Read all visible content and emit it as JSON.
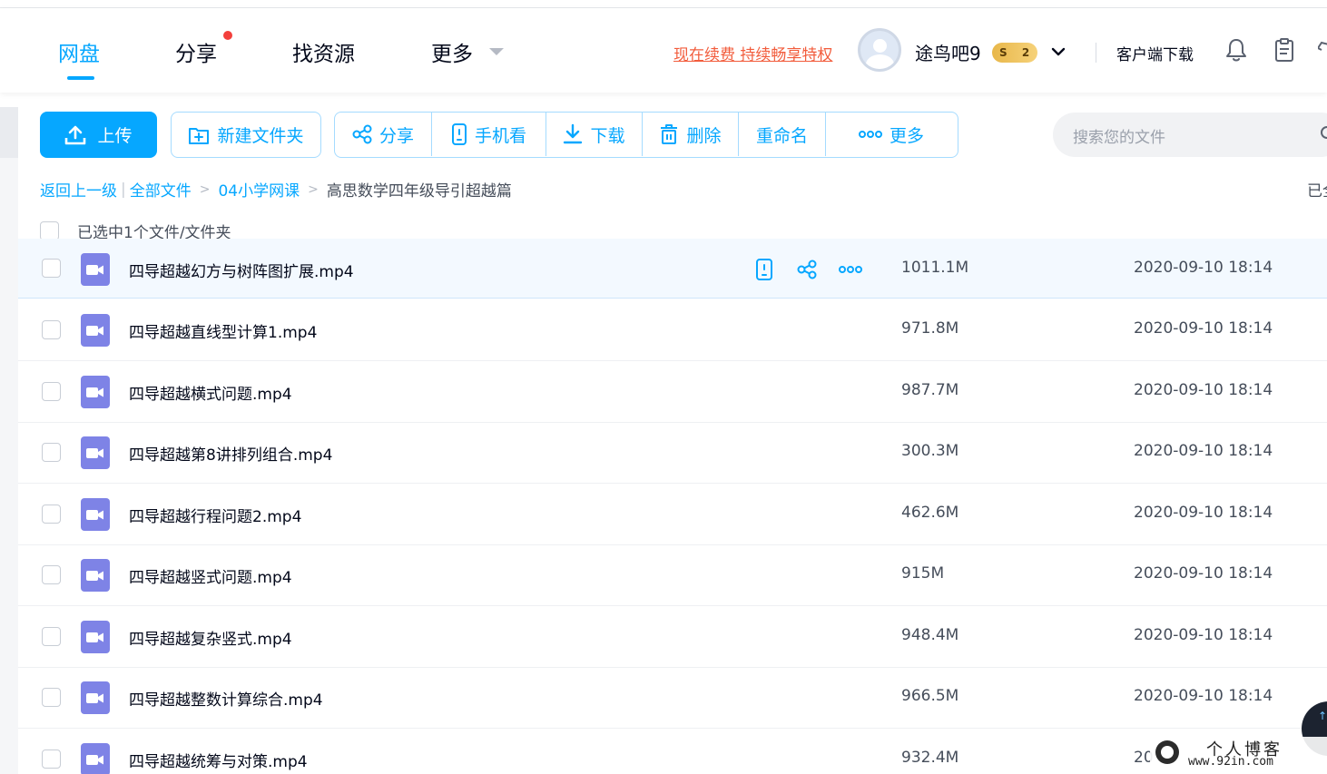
{
  "nav": {
    "items": [
      "网盘",
      "分享",
      "找资源",
      "更多"
    ],
    "active": "网盘",
    "promo": "现在续费 持续畅享特权",
    "username": "途鸟吧9",
    "vip_badge": "S 2",
    "client_download": "客户端下载"
  },
  "toolbar": {
    "upload": "上传",
    "new_folder": "新建文件夹",
    "share": "分享",
    "phone_watch": "手机看",
    "download": "下载",
    "delete": "删除",
    "rename": "重命名",
    "more": "更多"
  },
  "search": {
    "placeholder": "搜索您的文件"
  },
  "breadcrumb": {
    "back": "返回上一级",
    "all_files": "全部文件",
    "folder": "04小学网课",
    "current": "高思数学四年级导引超越篇",
    "right_text": "已全"
  },
  "selection": {
    "text": "已选中1个文件/文件夹"
  },
  "files": [
    {
      "name": "四导超越幻方与树阵图扩展.mp4",
      "size": "1011.1M",
      "date": "2020-09-10 18:14"
    },
    {
      "name": "四导超越直线型计算1.mp4",
      "size": "971.8M",
      "date": "2020-09-10 18:14"
    },
    {
      "name": "四导超越横式问题.mp4",
      "size": "987.7M",
      "date": "2020-09-10 18:14"
    },
    {
      "name": "四导超越第8讲排列组合.mp4",
      "size": "300.3M",
      "date": "2020-09-10 18:14"
    },
    {
      "name": "四导超越行程问题2.mp4",
      "size": "462.6M",
      "date": "2020-09-10 18:14"
    },
    {
      "name": "四导超越竖式问题.mp4",
      "size": "915M",
      "date": "2020-09-10 18:14"
    },
    {
      "name": "四导超越复杂竖式.mp4",
      "size": "948.4M",
      "date": "2020-09-10 18:14"
    },
    {
      "name": "四导超越整数计算综合.mp4",
      "size": "966.5M",
      "date": "2020-09-10 18:14"
    },
    {
      "name": "四导超越统筹与对策.mp4",
      "size": "932.4M",
      "date": "20"
    }
  ],
  "watermark": {
    "title": "个人博客",
    "url": "www.92in.com"
  },
  "colors": {
    "accent": "#06a7ff",
    "promo": "#f25c3c",
    "file_icon": "#7e83e6"
  }
}
